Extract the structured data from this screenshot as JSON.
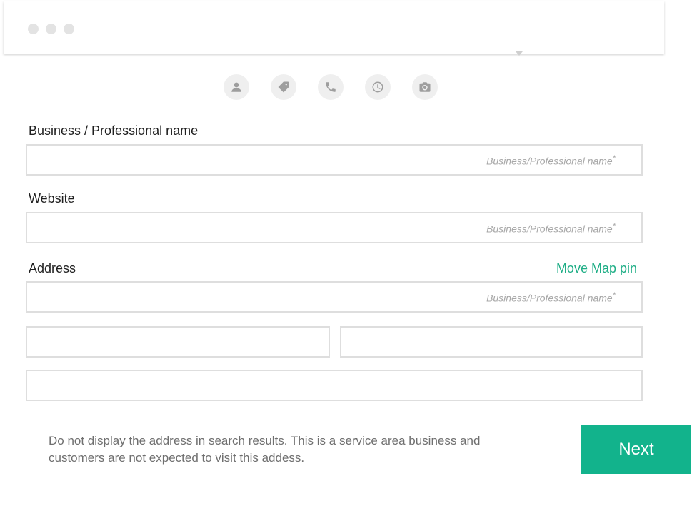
{
  "form": {
    "business_name": {
      "label": "Business / Professional name",
      "placeholder": "Business/Professional name",
      "required_mark": "*"
    },
    "website": {
      "label": "Website",
      "placeholder": "Business/Professional name",
      "required_mark": "*"
    },
    "address": {
      "label": "Address",
      "move_pin_link": "Move Map pin",
      "placeholder": "Business/Professional name",
      "required_mark": "*"
    },
    "note": "Do not display the address in search results. This is a service area business and customers are not expected to visit this addess.",
    "next_label": "Next"
  },
  "colors": {
    "accent": "#12b38c",
    "link": "#1fae86"
  }
}
